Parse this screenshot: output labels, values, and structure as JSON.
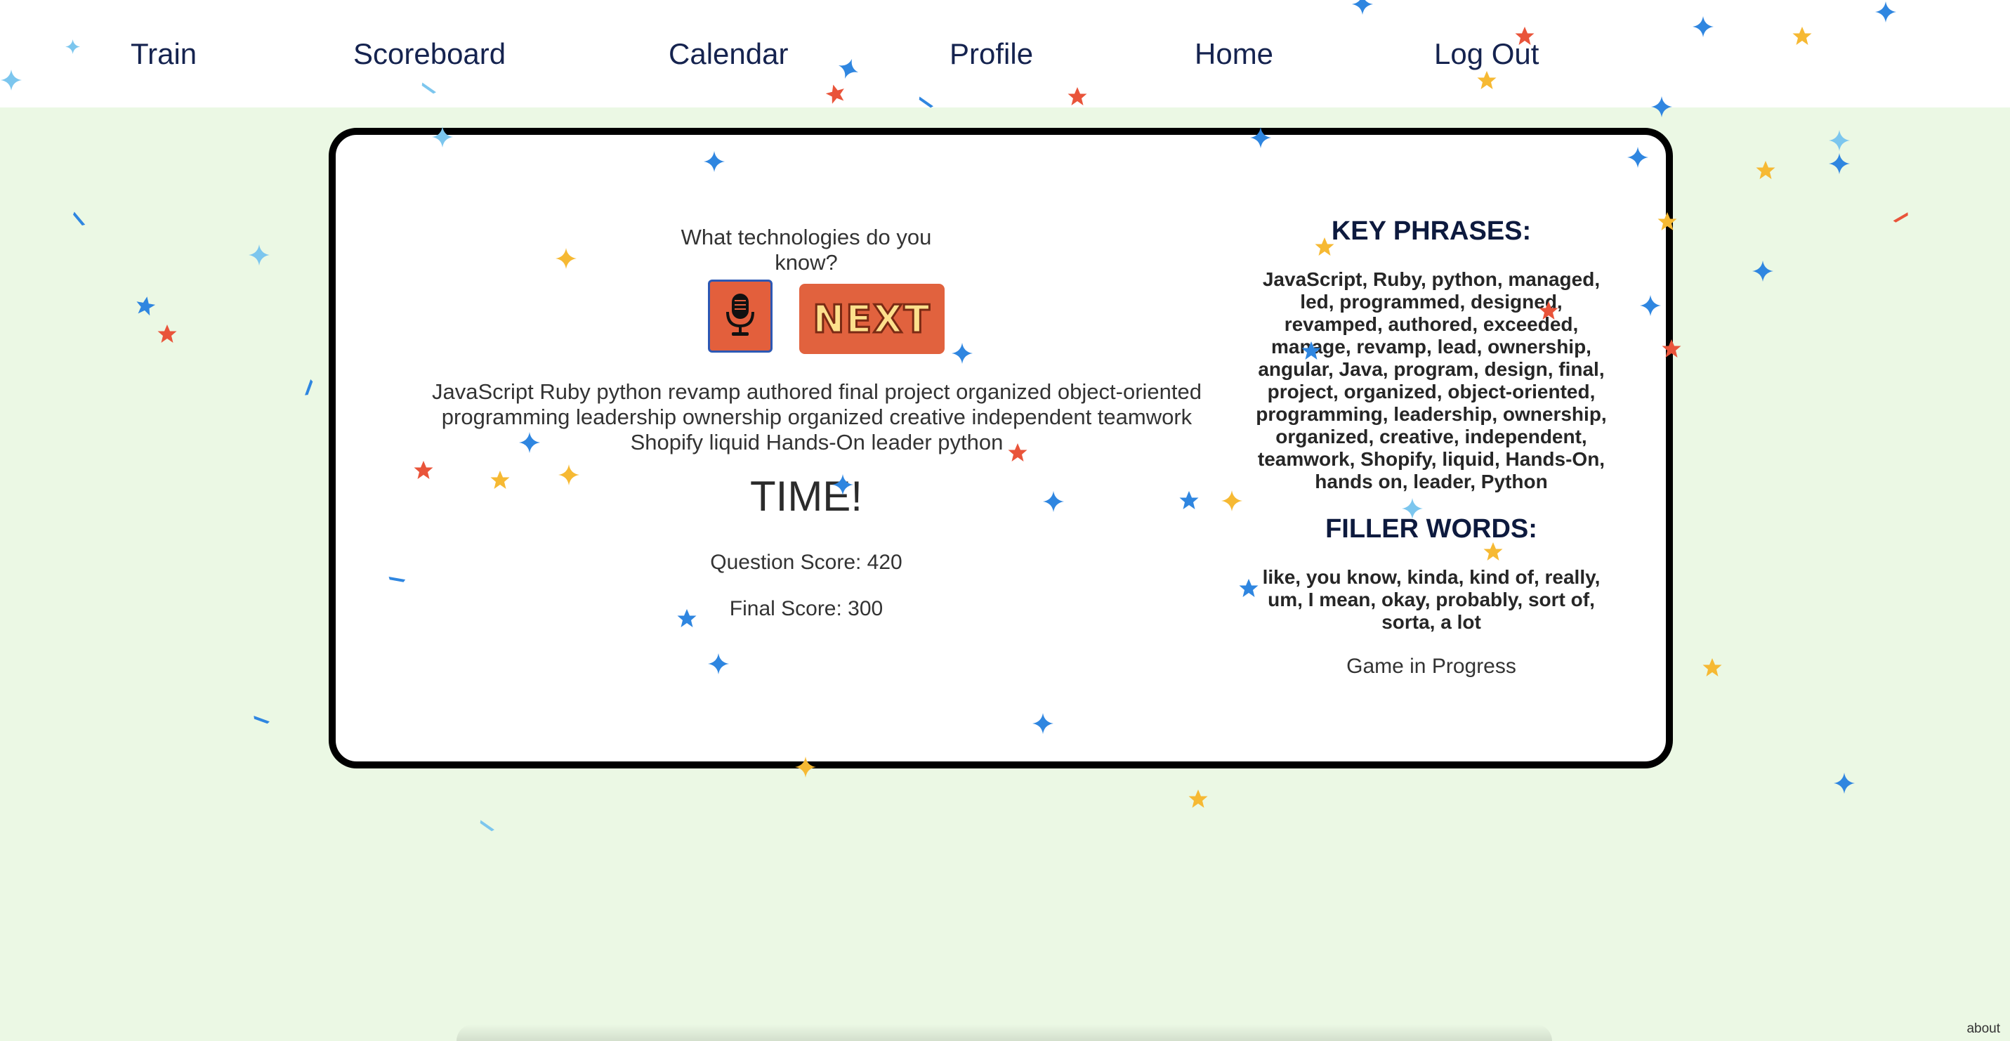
{
  "nav": {
    "items": [
      {
        "label": "Train"
      },
      {
        "label": "Scoreboard"
      },
      {
        "label": "Calendar"
      },
      {
        "label": "Profile"
      },
      {
        "label": "Home"
      },
      {
        "label": "Log Out"
      }
    ]
  },
  "game": {
    "question": "What technologies do you know?",
    "mic_icon": "microphone-icon",
    "next_label": "NEXT",
    "transcript": "JavaScript Ruby python revamp authored final project organized object-oriented programming leadership ownership organized creative independent teamwork Shopify liquid Hands-On leader python",
    "time_label": "TIME!",
    "question_score": "Question Score: 420",
    "final_score": "Final Score: 300"
  },
  "sidebar": {
    "key_phrases_title": "KEY PHRASES:",
    "key_phrases": "JavaScript, Ruby, python, managed, led, programmed, designed, revamped, authored, exceeded, manage, revamp, lead, ownership, angular, Java, program, design, final, project, organized, object-oriented, programming, leadership, ownership, organized, creative, independent, teamwork, Shopify, liquid, Hands-On, hands on, leader, Python",
    "filler_title": "FILLER WORDS:",
    "filler_words": "like, you know, kinda, kind of, really, um, I mean, okay, probably, sort of, sorta, a lot",
    "status": "Game in Progress"
  },
  "footer": {
    "about_label": "about"
  },
  "colors": {
    "page_background": "#ebf8e4",
    "nav_text": "#15234f",
    "button_orange": "#e35f3c",
    "confetti_blue": "#2f86e0",
    "confetti_light_blue": "#7cc6ee",
    "confetti_red": "#e9543a",
    "confetti_yellow": "#f6b933"
  }
}
